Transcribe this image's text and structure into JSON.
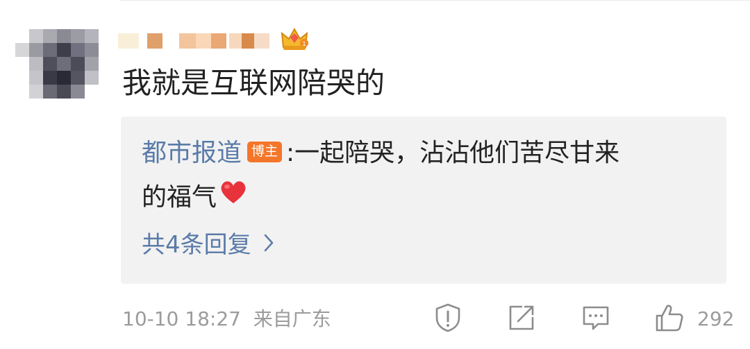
{
  "comment": {
    "text": "我就是互联网陪哭的",
    "username": "",
    "timestamp": "10-10 18:27",
    "source": "来自广东",
    "like_count": "292"
  },
  "reply": {
    "author": "都市报道",
    "badge": "博主",
    "separator": ":",
    "text_line1": "一起陪哭，沾沾他们苦尽甘来",
    "text_line2": "的福气",
    "more_label": "共4条回复"
  },
  "icons": {
    "report": "exclamation-shield-icon",
    "share": "share-arrow-icon",
    "comment": "comment-bubble-icon",
    "like": "thumbs-up-icon",
    "emoji": "red-heart-emoji",
    "badge": "crown-level-badge-icon"
  },
  "colors": {
    "link_blue": "#5a7ba8",
    "badge_orange": "#f4762a",
    "reply_bg": "#f2f2f2",
    "meta_gray": "#9b9b9b",
    "heart_red": "#e8323c"
  }
}
